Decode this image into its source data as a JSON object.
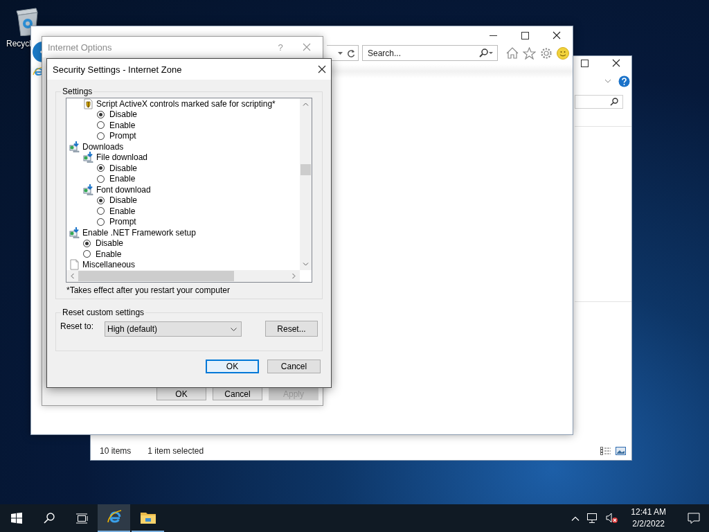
{
  "desktop": {
    "icons": [
      {
        "label": "Recycl"
      }
    ]
  },
  "explorer_window": {
    "status_bar": {
      "item_count": "10 items",
      "selection": "1 item selected"
    }
  },
  "browser_window": {
    "search": {
      "placeholder": "Search..."
    }
  },
  "internet_options": {
    "title": "Internet Options",
    "active": false,
    "help_button": "?",
    "buttons": [
      {
        "label": "OK",
        "disabled": false
      },
      {
        "label": "Cancel",
        "disabled": false
      },
      {
        "label": "Apply",
        "disabled": true
      }
    ]
  },
  "security_settings": {
    "title": "Security Settings - Internet Zone",
    "active": true,
    "settings_label": "Settings",
    "tree": {
      "continued": [
        {
          "kind": "script-setting",
          "label": "Script ActiveX controls marked safe for scripting*",
          "children": [
            {
              "kind": "radio",
              "label": "Disable",
              "selected": true
            },
            {
              "kind": "radio",
              "label": "Enable",
              "selected": false
            },
            {
              "kind": "radio",
              "label": "Prompt",
              "selected": false
            }
          ]
        }
      ],
      "items": [
        {
          "kind": "download-setting",
          "label": "Downloads",
          "children": [
            {
              "kind": "download-setting",
              "label": "File download",
              "children": [
                {
                  "kind": "radio",
                  "label": "Disable",
                  "selected": true
                },
                {
                  "kind": "radio",
                  "label": "Enable",
                  "selected": false
                }
              ]
            },
            {
              "kind": "download-setting",
              "label": "Font download",
              "children": [
                {
                  "kind": "radio",
                  "label": "Disable",
                  "selected": true
                },
                {
                  "kind": "radio",
                  "label": "Enable",
                  "selected": false
                },
                {
                  "kind": "radio",
                  "label": "Prompt",
                  "selected": false
                }
              ]
            }
          ]
        },
        {
          "kind": "download-setting",
          "label": "Enable .NET Framework setup",
          "children": [
            {
              "kind": "radio",
              "label": "Disable",
              "selected": true
            },
            {
              "kind": "radio",
              "label": "Enable",
              "selected": false
            }
          ]
        },
        {
          "kind": "page-setting",
          "label": "Miscellaneous"
        }
      ]
    },
    "note": "*Takes effect after you restart your computer",
    "reset_group": {
      "label": "Reset custom settings",
      "reset_to_label": "Reset to:",
      "value": "High (default)",
      "reset_button": "Reset..."
    },
    "buttons": [
      {
        "label": "OK",
        "default": true
      },
      {
        "label": "Cancel",
        "default": false
      }
    ]
  },
  "taskbar": {
    "apps": [
      {
        "kind": "browser",
        "selected": true
      },
      {
        "kind": "folder",
        "selected": false
      }
    ],
    "clock": {
      "time": "12:41 AM",
      "date": "2/2/2022"
    }
  }
}
